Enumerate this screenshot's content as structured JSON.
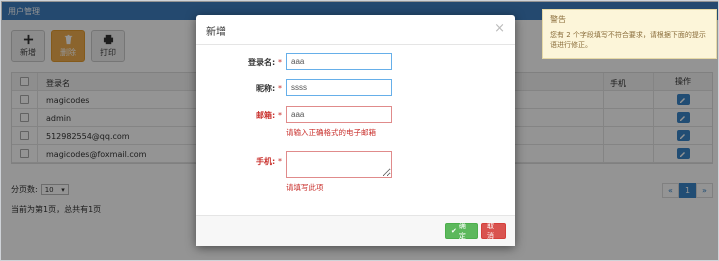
{
  "topbar": {
    "title": "用户管理"
  },
  "toolbar": {
    "add": "新增",
    "delete": "删除",
    "print": "打印"
  },
  "table": {
    "columns": [
      "登录名",
      "手机",
      "操作"
    ],
    "rows": [
      {
        "login": "magicodes"
      },
      {
        "login": "admin"
      },
      {
        "login": "512982554@qq.com"
      },
      {
        "login": "magicodes@foxmail.com"
      }
    ]
  },
  "pager": {
    "size_label": "分页数:",
    "size_value": "10",
    "info": "当前为第1页，总共有1页",
    "prev": "«",
    "current": "1",
    "next": "»"
  },
  "modal": {
    "title": "新增",
    "close": "×",
    "fields": {
      "login": {
        "label": "登录名:",
        "req": "*",
        "value": "aaa"
      },
      "nick": {
        "label": "昵称:",
        "req": "*",
        "value": "ssss"
      },
      "email": {
        "label": "邮箱:",
        "req": "*",
        "value": "aaa",
        "error": "请输入正确格式的电子邮箱"
      },
      "phone": {
        "label": "手机:",
        "req": "*",
        "value": "",
        "error": "请填写此项"
      }
    },
    "ok": "确定",
    "cancel": "取消"
  },
  "toast": {
    "title": "警告",
    "message": "您有 2 个字段填写不符合要求，请根据下面的提示语进行修正。"
  },
  "colors": {
    "primary": "#3a86c8",
    "danger": "#d9534f",
    "success": "#5cb85c",
    "warning": "#f0ad4e"
  }
}
